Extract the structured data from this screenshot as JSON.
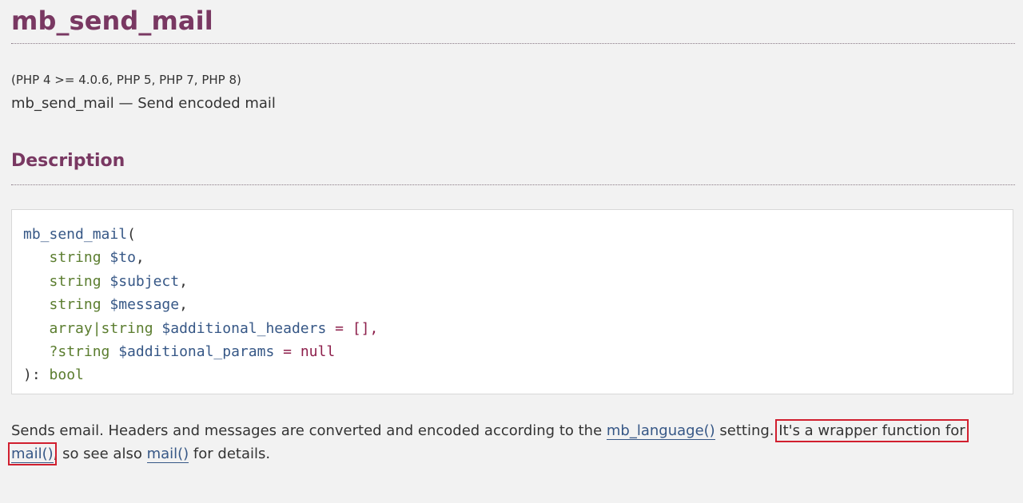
{
  "page": {
    "title": "mb_send_mail",
    "versions": "(PHP 4 >= 4.0.6, PHP 5, PHP 7, PHP 8)",
    "refname": "mb_send_mail — Send encoded mail",
    "section_title": "Description"
  },
  "synopsis": {
    "function_name": "mb_send_mail",
    "open_paren": "(",
    "params": [
      {
        "type": "string",
        "name": "$to",
        "suffix": ","
      },
      {
        "type": "string",
        "name": "$subject",
        "suffix": ","
      },
      {
        "type": "string",
        "name": "$message",
        "suffix": ","
      },
      {
        "type": "array|string",
        "name": "$additional_headers",
        "default": "= [],"
      },
      {
        "type": "?string",
        "name": "$additional_params",
        "default": "= null"
      }
    ],
    "close_paren": "):",
    "return_type": "bool"
  },
  "description": {
    "part1": "Sends email. Headers and messages are converted and encoded according to the ",
    "link1": "mb_language()",
    "part2": " setting. ",
    "highlight_text": "It's a wrapper function for ",
    "link2": "mail()",
    "part3": ", so see also ",
    "link3": "mail()",
    "part4": " for details."
  },
  "colors": {
    "title": "#793862",
    "link": "#365786",
    "type": "#5b7d2f",
    "highlight_box": "#d11f2f"
  }
}
